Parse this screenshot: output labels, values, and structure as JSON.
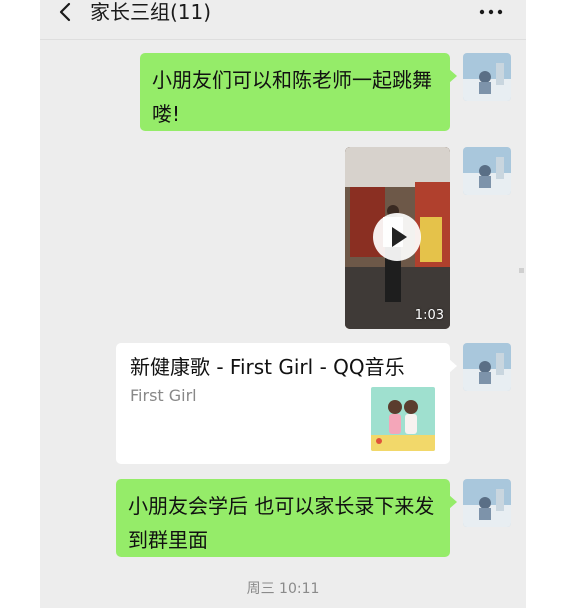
{
  "header": {
    "title": "家长三组(11)",
    "back_icon": "chevron-left-icon",
    "more_icon": "more-dots-icon"
  },
  "messages": [
    {
      "type": "text",
      "sender": "self",
      "lines": [
        "小朋友们可以和陈老师一起跳舞",
        "喽!"
      ]
    },
    {
      "type": "video",
      "sender": "self",
      "duration": "1:03"
    },
    {
      "type": "music_card",
      "sender": "self",
      "title": "新健康歌 - First Girl - QQ音乐",
      "subtitle": "First Girl"
    },
    {
      "type": "text",
      "sender": "self",
      "lines": [
        "小朋友会学后 也可以家长录下来发",
        "到群里面"
      ]
    }
  ],
  "timestamp": "周三 10:11",
  "colors": {
    "chat_bg": "#ededed",
    "self_bubble": "#95ec69",
    "card_bg": "#ffffff",
    "timestamp_text": "#8a8a8a"
  }
}
